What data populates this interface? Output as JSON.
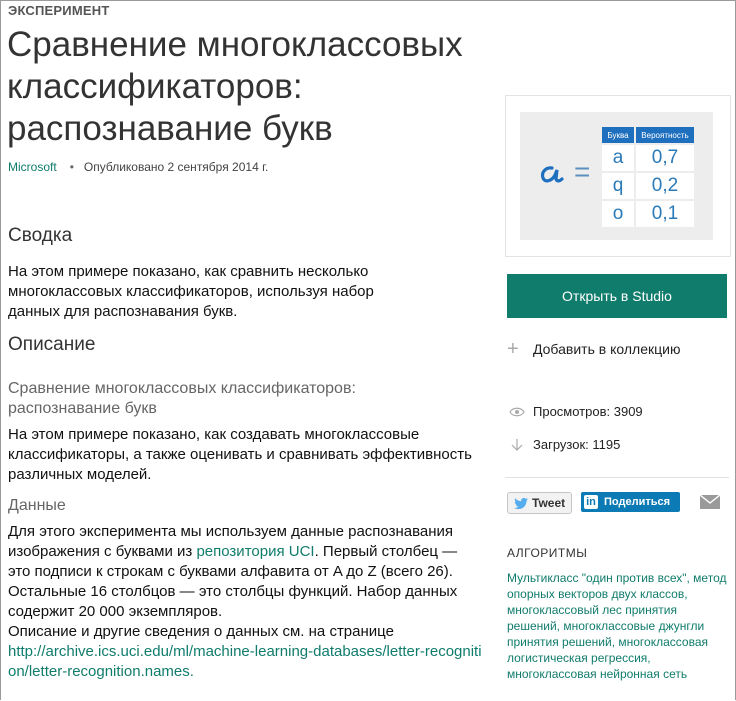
{
  "header": {
    "kicker": "ЭКСПЕРИМЕНТ",
    "title": "Сравнение многоклассовых классификаторов: распознавание букв",
    "publisher": "Microsoft",
    "published": "Опубликовано 2 сентября 2014 г."
  },
  "summary": {
    "heading": "Сводка",
    "text": "На этом примере показано, как сравнить несколько многоклассовых классификаторов, используя набор данных для распознавания букв."
  },
  "description": {
    "heading": "Описание",
    "subheading": "Сравнение многоклассовых классификаторов: распознавание букв",
    "text": "На этом примере показано, как создавать многоклассовые классификаторы, а также оценивать и сравнивать эффективность различных моделей.",
    "data_heading": "Данные",
    "data_text_1": "Для этого эксперимента мы используем данные распознавания изображения с буквами из ",
    "data_link": "репозитория UCI",
    "data_text_2": ". Первый столбец — это подписи к строкам с буквами алфавита от A до Z (всего 26). Остальные 16 столбцов — это столбцы функций. Набор данных содержит 20 000 экземпляров.",
    "data_text_3": "Описание и другие сведения о данных см. на странице",
    "data_url": "http://archive.ics.uci.edu/ml/machine-learning-databases/letter-recognition/letter-recognition.names."
  },
  "thumbnail": {
    "col_letter": "Буква",
    "col_prob": "Вероятность",
    "rows": [
      {
        "letter": "a",
        "prob": "0,7"
      },
      {
        "letter": "q",
        "prob": "0,2"
      },
      {
        "letter": "o",
        "prob": "0,1"
      }
    ]
  },
  "sidebar": {
    "open_button": "Открыть в Studio",
    "add_collection": "Добавить в коллекцию",
    "views": "Просмотров: 3909",
    "downloads": "Загрузок: 1195",
    "tweet": "Tweet",
    "share": "Поделиться",
    "algorithms_heading": "АЛГОРИТМЫ",
    "algorithms": "Мультикласс \"один против всех\", метод опорных векторов двух классов, многоклассовый лес принятия решений, многоклассовые джунгли принятия решений, многоклассовая логистическая регрессия, многоклассовая нейронная сеть"
  },
  "colors": {
    "accent": "#107c6c",
    "table_header": "#1f6fbf",
    "linkedin": "#0c7bb5"
  }
}
